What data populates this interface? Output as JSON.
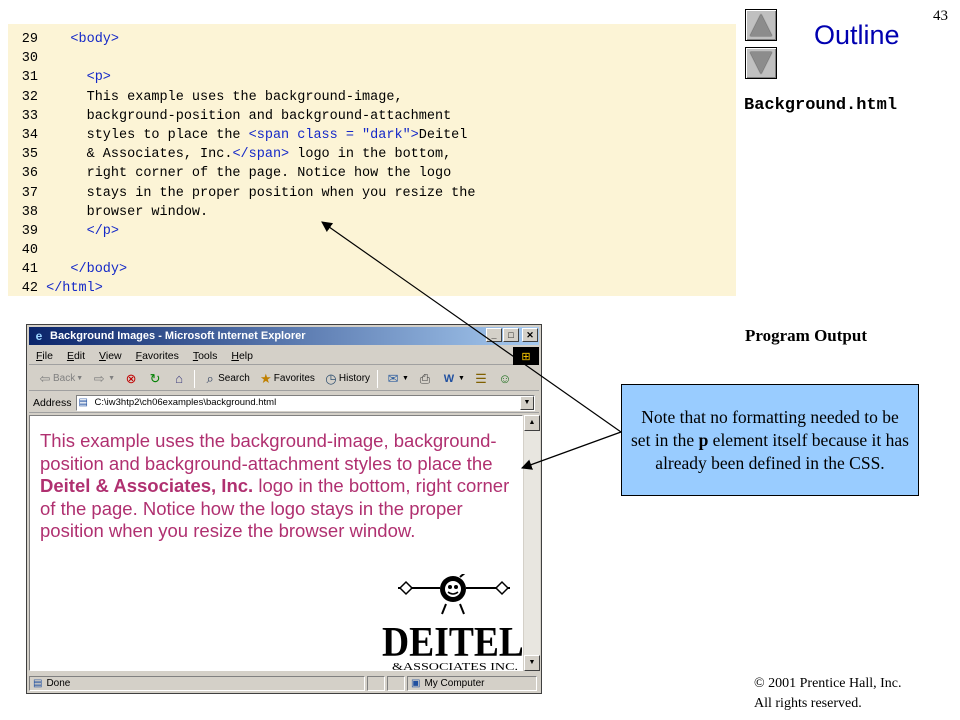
{
  "slide": {
    "page_number": "43",
    "outline_title": "Outline",
    "file_name": "Background.html",
    "program_output": "Program Output",
    "copyright_line1": "© 2001 Prentice Hall, Inc.",
    "copyright_line2": "All rights reserved."
  },
  "code": {
    "lines": [
      {
        "n": "29",
        "segs": [
          {
            "t": "    ",
            "k": "text"
          },
          {
            "t": "<body>",
            "k": "tag"
          }
        ]
      },
      {
        "n": "30",
        "segs": []
      },
      {
        "n": "31",
        "segs": [
          {
            "t": "      ",
            "k": "text"
          },
          {
            "t": "<p>",
            "k": "tag"
          }
        ]
      },
      {
        "n": "32",
        "segs": [
          {
            "t": "      This example uses the background-image,",
            "k": "text"
          }
        ]
      },
      {
        "n": "33",
        "segs": [
          {
            "t": "      background-position and background-attachment",
            "k": "text"
          }
        ]
      },
      {
        "n": "34",
        "segs": [
          {
            "t": "      styles to place the ",
            "k": "text"
          },
          {
            "t": "<span class = \"dark\">",
            "k": "tag"
          },
          {
            "t": "Deitel",
            "k": "text"
          }
        ]
      },
      {
        "n": "35",
        "segs": [
          {
            "t": "      & Associates, Inc.",
            "k": "text"
          },
          {
            "t": "</span>",
            "k": "tag"
          },
          {
            "t": " logo in the bottom,",
            "k": "text"
          }
        ]
      },
      {
        "n": "36",
        "segs": [
          {
            "t": "      right corner of the page. Notice how the logo",
            "k": "text"
          }
        ]
      },
      {
        "n": "37",
        "segs": [
          {
            "t": "      stays in the proper position when you resize the",
            "k": "text"
          }
        ]
      },
      {
        "n": "38",
        "segs": [
          {
            "t": "      browser window.",
            "k": "text"
          }
        ]
      },
      {
        "n": "39",
        "segs": [
          {
            "t": "      ",
            "k": "text"
          },
          {
            "t": "</p>",
            "k": "tag"
          }
        ]
      },
      {
        "n": "40",
        "segs": []
      },
      {
        "n": "41",
        "segs": [
          {
            "t": "    ",
            "k": "text"
          },
          {
            "t": "</body>",
            "k": "tag"
          }
        ]
      },
      {
        "n": "42",
        "segs": [
          {
            "t": " ",
            "k": "text"
          },
          {
            "t": "</html>",
            "k": "tag"
          }
        ]
      }
    ]
  },
  "callout": {
    "part1": "Note that no formatting needed to be set in the ",
    "bold": "p",
    "part2": " element itself because it has already been defined in the CSS."
  },
  "browser": {
    "title": "Background Images - Microsoft Internet Explorer",
    "menu": [
      "File",
      "Edit",
      "View",
      "Favorites",
      "Tools",
      "Help"
    ],
    "toolbar": {
      "back": "Back",
      "search": "Search",
      "favorites": "Favorites",
      "history": "History"
    },
    "address_label": "Address",
    "address_value": "C:\\iw3htp2\\ch06examples\\background.html",
    "page": {
      "text_before": "This example uses the background-image, background-position and background-attachment styles to place the ",
      "text_bold": "Deitel & Associates, Inc.",
      "text_after": " logo in the bottom, right corner of the page. Notice how the logo stays in the proper position when you resize the browser window.",
      "logo_word": "DEITEL",
      "logo_sub": "&ASSOCIATES INC."
    },
    "status_left": "Done",
    "status_zone": "My Computer"
  },
  "colors": {
    "code_background": "#fcf4d6",
    "code_tag": "#1428c8",
    "outline_title": "#0000b0",
    "callout_background": "#99ccff",
    "page_text": "#b03070"
  },
  "icons": [
    "nav-up-icon",
    "nav-down-icon",
    "ie-icon",
    "back-icon",
    "forward-icon",
    "stop-icon",
    "refresh-icon",
    "home-icon",
    "search-icon",
    "favorites-icon",
    "history-icon",
    "mail-icon",
    "print-icon",
    "edit-icon",
    "discuss-icon",
    "messenger-icon",
    "windows-logo-icon",
    "page-icon",
    "computer-icon"
  ]
}
